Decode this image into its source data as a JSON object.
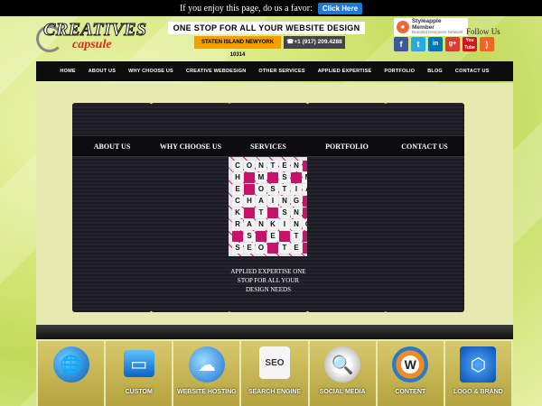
{
  "favor_bar": {
    "text": "If you enjoy this page, do us a favor:",
    "button": "Click Here"
  },
  "header": {
    "logo_top": "CREATIVES",
    "logo_bottom": "capsule",
    "tagline": "ONE STOP FOR ALL YOUR WEBSITE DESIGN NEEDS",
    "location": "STATEN ISLAND NEWYORK 10314",
    "phone": "+1 (917) 209.4288",
    "badge_title": "Styleapple Member",
    "badge_sub": "Branded Designers Network",
    "follow_label": "Follow Us",
    "social": [
      "facebook-icon",
      "twitter-icon",
      "linkedin-icon",
      "googleplus-icon",
      "youtube-icon",
      "rss-icon"
    ],
    "social_glyphs": {
      "fb": "f",
      "tw": "t",
      "in": "in",
      "gp": "g+",
      "yt": "You Tube",
      "rss": ")"
    }
  },
  "nav": [
    "HOME",
    "ABOUT US",
    "WHY CHOOSE US",
    "CREATIVE WEBDESIGN",
    "OTHER SERVICES",
    "APPLIED EXPERTISE",
    "PORTFOLIO",
    "BLOG",
    "CONTACT US"
  ],
  "panels": [
    {
      "label": "ABOUT US"
    },
    {
      "label": "WHY CHOOSE US"
    },
    {
      "label": "SERVICES",
      "caption": "APPLIED EXPERTISE ONE STOP FOR ALL YOUR DESIGN NEEDS"
    },
    {
      "label": "PORTFOLIO"
    },
    {
      "label": "CONTACT US"
    }
  ],
  "services": [
    {
      "label": "",
      "icon": "globe-icon"
    },
    {
      "label": "CUSTOM",
      "icon": "monitor-icon"
    },
    {
      "label": "WEBSITE HOSTING",
      "icon": "cloud-globe-icon"
    },
    {
      "label": "SEARCH ENGINE",
      "icon": "seo-blocks-icon"
    },
    {
      "label": "SOCIAL MEDIA",
      "icon": "magnifier-icon"
    },
    {
      "label": "CONTENT",
      "icon": "wordpress-icon"
    },
    {
      "label": "LOGO & BRAND",
      "icon": "brand-network-icon"
    }
  ]
}
